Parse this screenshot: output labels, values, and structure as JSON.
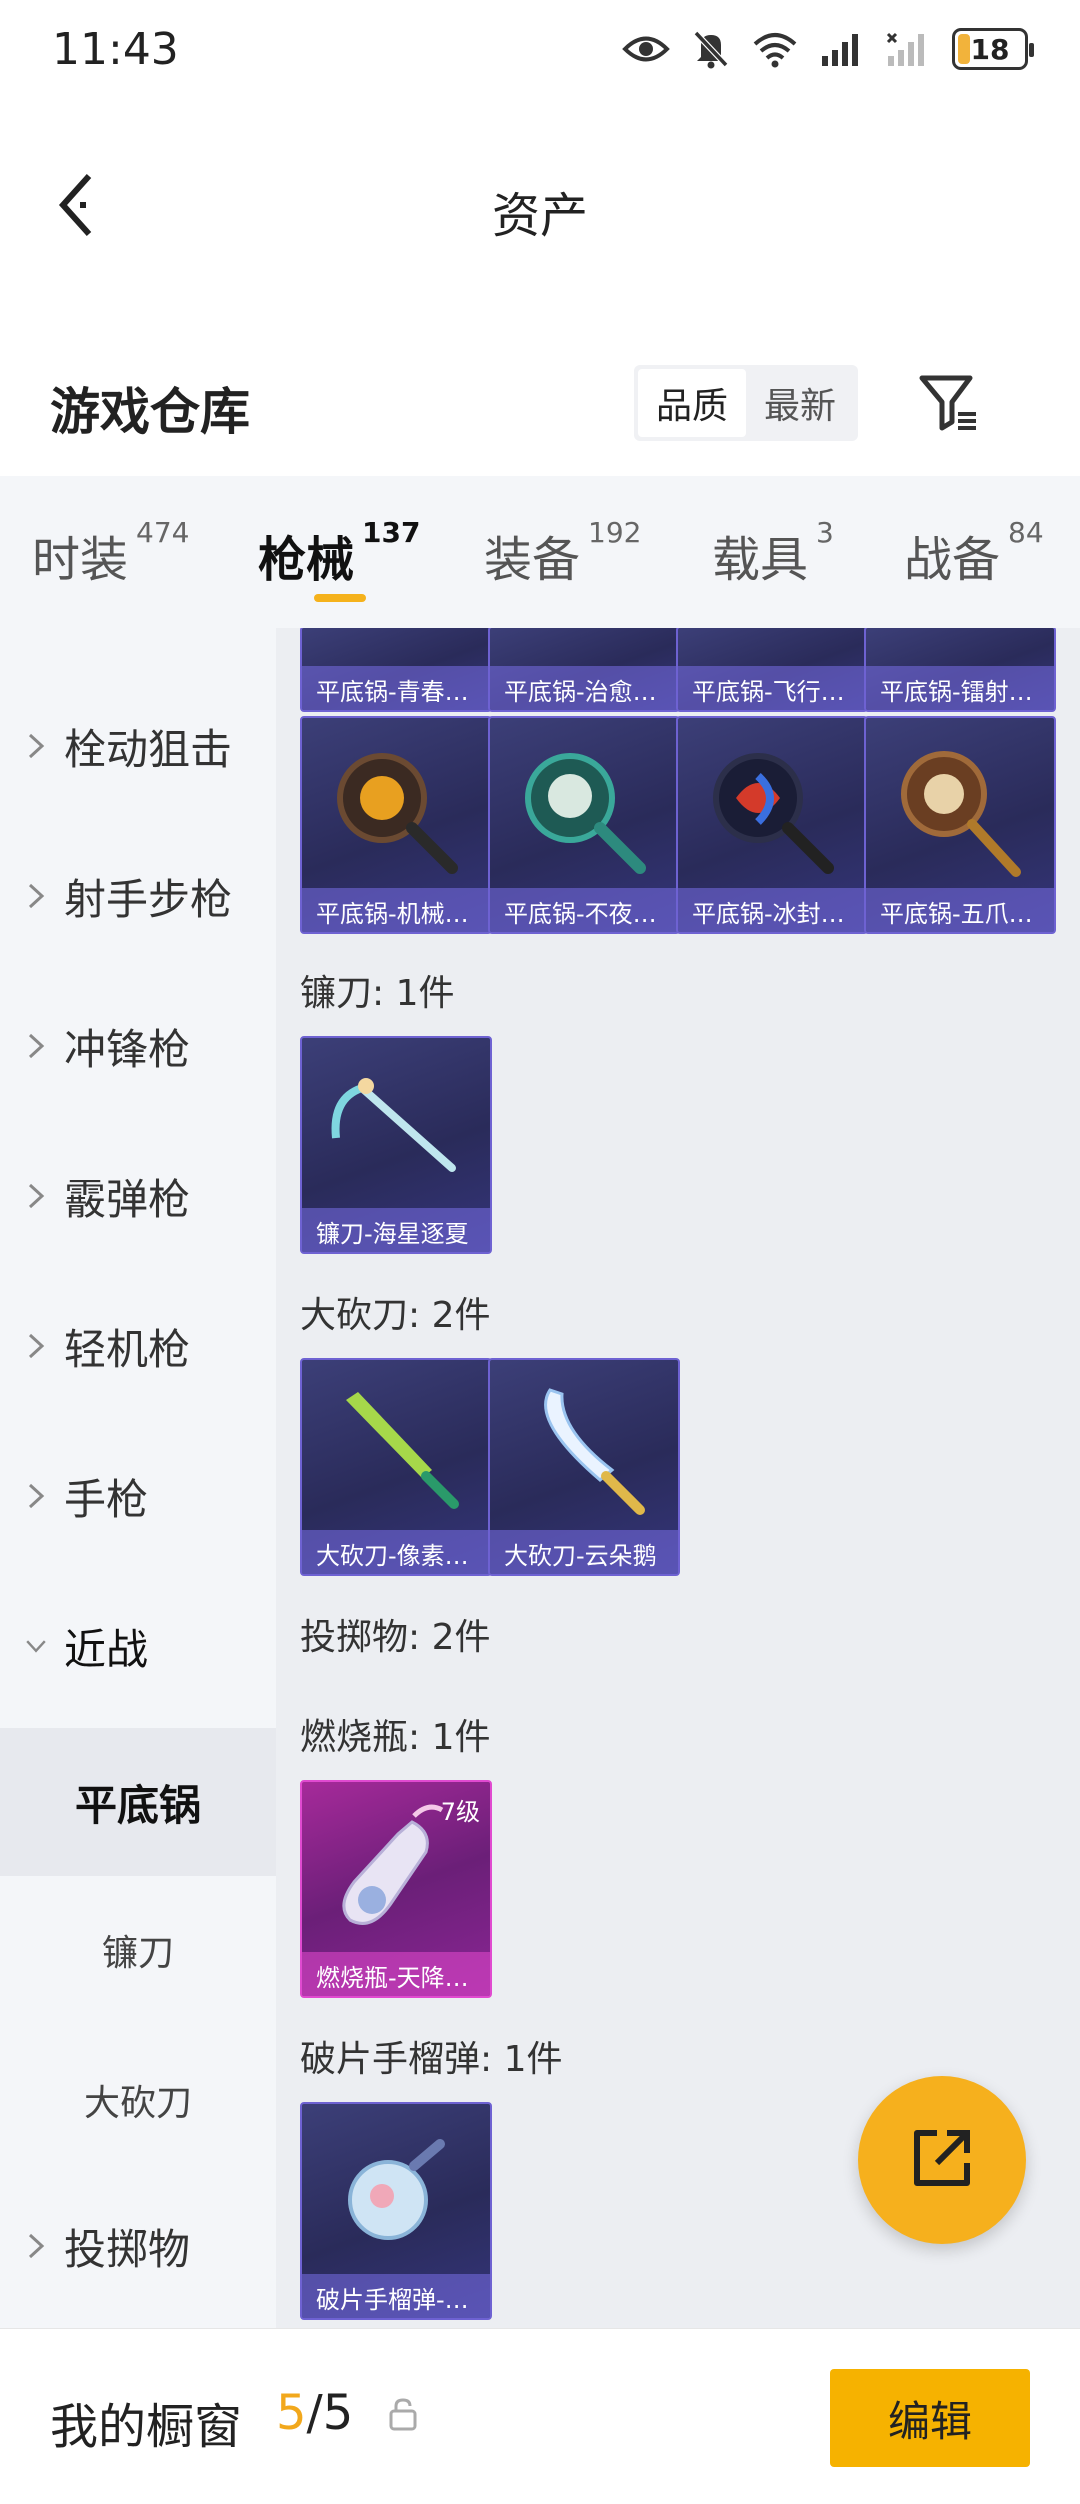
{
  "status": {
    "time": "11:43",
    "battery": "18",
    "battery_level": 0.18
  },
  "header": {
    "title": "资产"
  },
  "section": {
    "title": "游戏仓库",
    "sort_options": [
      "品质",
      "最新"
    ],
    "sort_active": "品质"
  },
  "tabs": [
    {
      "label": "时装",
      "count": "474"
    },
    {
      "label": "枪械",
      "count": "137",
      "active": true
    },
    {
      "label": "装备",
      "count": "192"
    },
    {
      "label": "载具",
      "count": "3"
    },
    {
      "label": "战备",
      "count": "84"
    }
  ],
  "sidebar": {
    "items": [
      "栓动狙击",
      "射手步枪",
      "冲锋枪",
      "霰弹枪",
      "轻机枪",
      "手枪",
      "近战",
      "投掷物"
    ],
    "subitems": [
      "平底锅",
      "镰刀",
      "大砍刀"
    ],
    "active_subitem": "平底锅"
  },
  "content": {
    "pan_row_top": [
      "平底锅-青春…",
      "平底锅-治愈…",
      "平底锅-飞行…",
      "平底锅-镭射…"
    ],
    "pan_row": [
      "平底锅-机械…",
      "平底锅-不夜…",
      "平底锅-冰封…",
      "平底锅-五爪…"
    ],
    "scythe_label": "镰刀: 1件",
    "scythe_items": [
      "镰刀-海星逐夏"
    ],
    "machete_label": "大砍刀: 2件",
    "machete_items": [
      "大砍刀-像素…",
      "大砍刀-云朵鹅"
    ],
    "throwable_label": "投掷物: 2件",
    "molotov_label": "燃烧瓶: 1件",
    "molotov_items": [
      {
        "name": "燃烧瓶-天降…",
        "level": "7级"
      }
    ],
    "frag_label": "破片手榴弹: 1件",
    "frag_items": [
      "破片手榴弹-…"
    ]
  },
  "bottom": {
    "title": "我的橱窗",
    "current": "5",
    "separator": "/",
    "total": "5",
    "edit_label": "编辑"
  },
  "colors": {
    "accent": "#f6b200",
    "card_border": "#6e62d2",
    "card_pink": "#e04ad0"
  },
  "icons": [
    "back-arrow-icon",
    "filter-icon",
    "share-icon",
    "lock-icon",
    "eye-icon",
    "mute-icon",
    "wifi-icon",
    "signal-icon"
  ]
}
